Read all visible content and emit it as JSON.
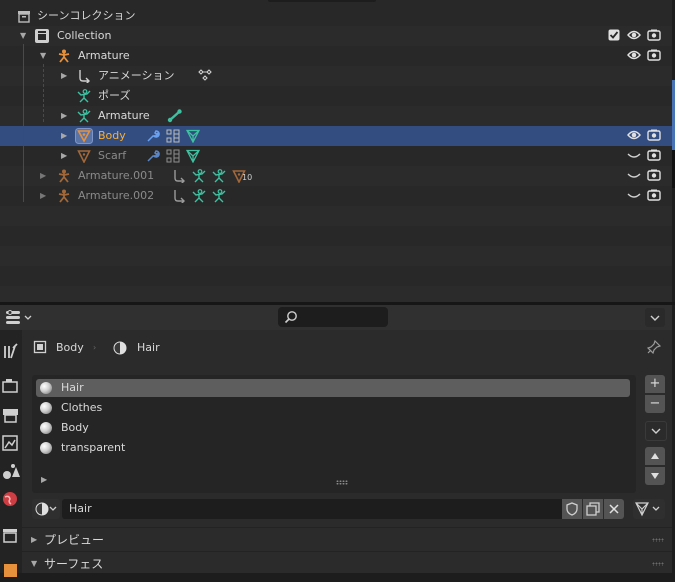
{
  "outliner": {
    "scene_collection": "シーンコレクション",
    "collection": "Collection",
    "armature": "Armature",
    "animation": "アニメーション",
    "pose": "ポーズ",
    "armature_data": "Armature",
    "body": "Body",
    "scarf": "Scarf",
    "armature_001": "Armature.001",
    "armature_001_badge": "10",
    "armature_002": "Armature.002"
  },
  "properties": {
    "breadcrumb_object": "Body",
    "breadcrumb_material": "Hair",
    "material_slots": [
      "Hair",
      "Clothes",
      "Body",
      "transparent"
    ],
    "selected_slot": 0,
    "material_name": "Hair",
    "panels": {
      "preview": "プレビュー",
      "surface": "サーフェス"
    }
  },
  "colors": {
    "selection": "#334d80",
    "object_orange": "#ffaf29",
    "bone_green": "#1ea59a",
    "mesh_green": "#3fc0a0"
  }
}
